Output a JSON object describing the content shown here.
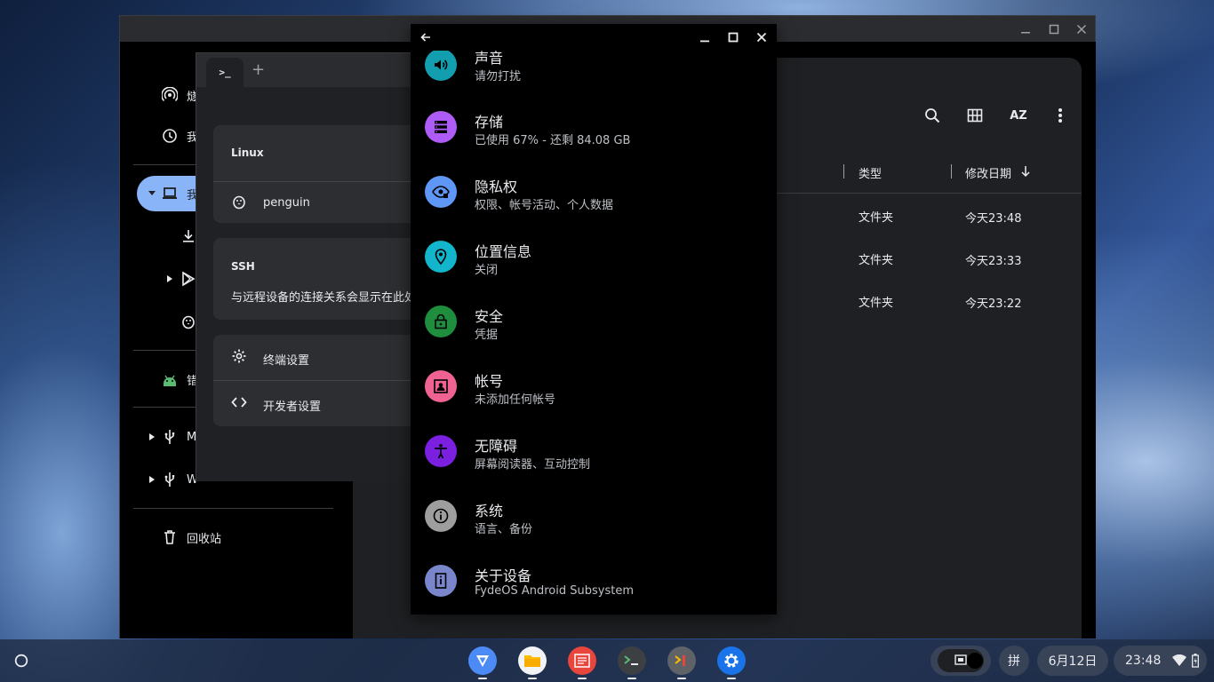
{
  "files_app": {
    "sidebar": {
      "items": [
        {
          "label": "燧"
        },
        {
          "label": "我"
        },
        {
          "label": "我"
        },
        {
          "label": "错"
        },
        {
          "label": "M"
        },
        {
          "label": "W"
        },
        {
          "label": "回收站"
        }
      ]
    },
    "columns": {
      "type": "类型",
      "modified": "修改日期"
    },
    "rows": [
      {
        "type": "文件夹",
        "modified": "今天23:48"
      },
      {
        "type": "文件夹",
        "modified": "今天23:33"
      },
      {
        "type": "文件夹",
        "modified": "今天23:22"
      }
    ],
    "toolbar": {
      "sort_label": "AZ"
    }
  },
  "terminal": {
    "tab_label": ">_",
    "new_tab": "+",
    "linux": {
      "title": "Linux",
      "container": "penguin"
    },
    "ssh": {
      "title": "SSH",
      "text": "与远程设备的连接关系会显示在此处"
    },
    "settings": {
      "terminal_settings": "终端设置",
      "developer_settings": "开发者设置"
    }
  },
  "android_settings": {
    "items": [
      {
        "title": "声音",
        "subtitle": "请勿打扰",
        "icon": "volume-icon",
        "color": "#129eaf"
      },
      {
        "title": "存储",
        "subtitle": "已使用 67% - 还剩 84.08 GB",
        "icon": "storage-icon",
        "color": "#af5cf7"
      },
      {
        "title": "隐私权",
        "subtitle": "权限、帐号活动、个人数据",
        "icon": "privacy-icon",
        "color": "#5e97f6"
      },
      {
        "title": "位置信息",
        "subtitle": "关闭",
        "icon": "location-icon",
        "color": "#12b5cb"
      },
      {
        "title": "安全",
        "subtitle": "凭据",
        "icon": "lock-icon",
        "color": "#1e8e3e"
      },
      {
        "title": "帐号",
        "subtitle": "未添加任何帐号",
        "icon": "account-icon",
        "color": "#f06292"
      },
      {
        "title": "无障碍",
        "subtitle": "屏幕阅读器、互动控制",
        "icon": "accessibility-icon",
        "color": "#7b1fe0"
      },
      {
        "title": "系统",
        "subtitle": "语言、备份",
        "icon": "info-icon",
        "color": "#9e9e9e"
      },
      {
        "title": "关于设备",
        "subtitle": "FydeOS Android Subsystem",
        "icon": "device-icon",
        "color": "#7986cb"
      }
    ]
  },
  "shelf": {
    "ime": "拼",
    "date": "6月12日",
    "time": "23:48"
  }
}
